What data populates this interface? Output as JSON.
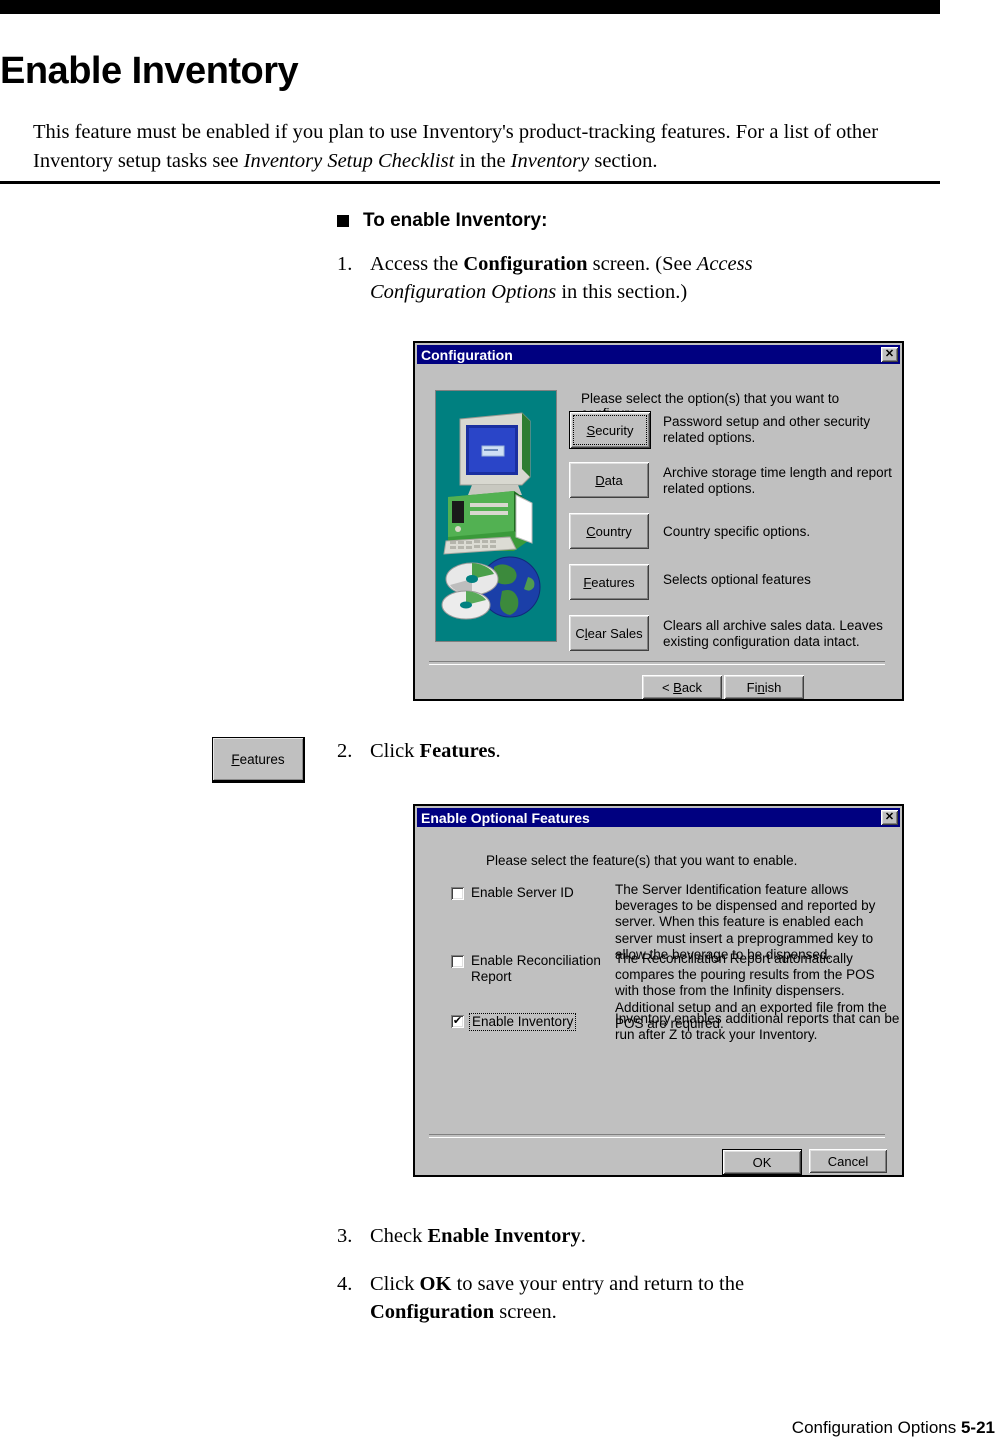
{
  "page": {
    "title": "Enable Inventory",
    "intro_1": "This feature must be enabled if you plan to use Inventory's product-tracking features. For a list of other Inventory setup tasks see ",
    "intro_italic_1": "Inventory Setup Checklist",
    "intro_2": " in the ",
    "intro_italic_2": "Inventory",
    "intro_3": " section.",
    "footer_section": "Configuration Options",
    "footer_page": "5-21"
  },
  "procedure": {
    "heading": "To enable Inventory:",
    "steps": [
      {
        "num": "1.",
        "pre": "Access the ",
        "bold": "Configuration",
        "mid": " screen. (See ",
        "italic": "Access Configuration Options",
        "post": " in this section.)"
      },
      {
        "num": "2.",
        "pre": "Click ",
        "bold": "Features",
        "post": "."
      },
      {
        "num": "3.",
        "pre": "Check ",
        "bold": "Enable Inventory",
        "post": "."
      },
      {
        "num": "4.",
        "pre": "Click ",
        "bold": "OK",
        "mid": " to save your entry and return to the ",
        "bold2": "Configuration",
        "post": " screen."
      }
    ]
  },
  "margin_callout": {
    "features_button_label": "Features",
    "accel": "F"
  },
  "config_dialog": {
    "title": "Configuration",
    "close_icon": "close-icon",
    "prompt": "Please select the option(s) that you want to configure.",
    "options": [
      {
        "label": "Security",
        "accel": "S",
        "desc": "Password setup and other security related options.",
        "focused": true
      },
      {
        "label": "Data",
        "accel": "D",
        "desc": "Archive storage time length and report related options.",
        "focused": false
      },
      {
        "label": "Country",
        "accel": "C",
        "desc": "Country specific options.",
        "focused": false
      },
      {
        "label": "Features",
        "accel": "F",
        "desc": "Selects optional features",
        "focused": false
      },
      {
        "label": "Clear Sales",
        "accel": "l",
        "desc": "Clears all archive sales data.  Leaves existing configuration data intact.",
        "focused": false
      }
    ],
    "nav": {
      "back": "< Back",
      "back_accel": "B",
      "finish": "Finish",
      "finish_accel": "n"
    },
    "image_panel_color": "#008080"
  },
  "features_dialog": {
    "title": "Enable Optional Features",
    "close_icon": "close-icon",
    "prompt": "Please select the feature(s) that you want to enable.",
    "checkboxes": [
      {
        "label": "Enable Server ID",
        "checked": false,
        "focused": false,
        "desc": "The Server Identification feature allows beverages to be dispensed and reported by server.  When this feature is enabled each server must insert a preprogrammed key to allow the beverage to be dispensed."
      },
      {
        "label": "Enable Reconciliation\nReport",
        "checked": false,
        "focused": false,
        "desc": "The Reconciliation Report automatically compares the pouring results from the POS with those from the Infinity dispensers. Additional setup and an exported file from the POS are required."
      },
      {
        "label": "Enable Inventory",
        "checked": true,
        "focused": true,
        "desc": "Inventory enables additional reports that can be run after Z to track your Inventory."
      }
    ],
    "buttons": {
      "ok": "OK",
      "cancel": "Cancel"
    }
  },
  "colors": {
    "titlebar": "#000080",
    "dialog_face": "#c0c0c0",
    "image_panel": "#008080",
    "text": "#000000"
  }
}
